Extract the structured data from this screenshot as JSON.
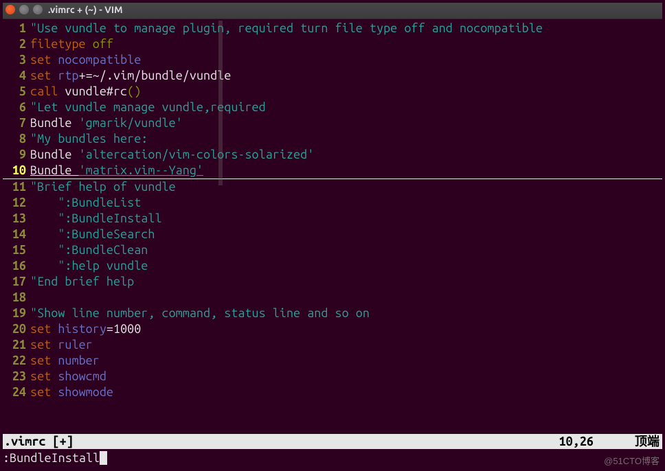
{
  "window": {
    "title": ".vimrc + (~) - VIM"
  },
  "editor": {
    "lines": [
      {
        "n": 1,
        "tokens": [
          {
            "cls": "c-comment",
            "t": "\"Use vundle to manage plugin, required turn file type off and nocompatible"
          }
        ]
      },
      {
        "n": 2,
        "tokens": [
          {
            "cls": "c-statement",
            "t": "filetype"
          },
          {
            "cls": "c-plain",
            "t": " "
          },
          {
            "cls": "c-paren",
            "t": "off"
          }
        ]
      },
      {
        "n": 3,
        "tokens": [
          {
            "cls": "c-statement",
            "t": "set"
          },
          {
            "cls": "c-plain",
            "t": " "
          },
          {
            "cls": "c-option",
            "t": "nocompatible"
          }
        ]
      },
      {
        "n": 4,
        "tokens": [
          {
            "cls": "c-statement",
            "t": "set"
          },
          {
            "cls": "c-plain",
            "t": " "
          },
          {
            "cls": "c-option",
            "t": "rtp"
          },
          {
            "cls": "c-plain",
            "t": "+=~/.vim/bundle/vundle"
          }
        ]
      },
      {
        "n": 5,
        "tokens": [
          {
            "cls": "c-statement",
            "t": "call"
          },
          {
            "cls": "c-plain",
            "t": " "
          },
          {
            "cls": "c-plain",
            "t": "vundle#rc"
          },
          {
            "cls": "c-paren",
            "t": "()"
          }
        ]
      },
      {
        "n": 6,
        "tokens": [
          {
            "cls": "c-comment",
            "t": "\"Let vundle manage vundle,required"
          }
        ]
      },
      {
        "n": 7,
        "tokens": [
          {
            "cls": "c-plain",
            "t": "Bundle "
          },
          {
            "cls": "c-string",
            "t": "'gmarik/vundle'"
          }
        ]
      },
      {
        "n": 8,
        "tokens": [
          {
            "cls": "c-comment",
            "t": "\"My bundles here:"
          }
        ]
      },
      {
        "n": 9,
        "tokens": [
          {
            "cls": "c-plain",
            "t": "Bundle "
          },
          {
            "cls": "c-string",
            "t": "'altercation/vim-colors-solarized'"
          }
        ]
      },
      {
        "n": 10,
        "cur": true,
        "tokens": [
          {
            "cls": "c-curcmd",
            "t": "Bundle "
          },
          {
            "cls": "c-curstr",
            "t": "'matrix.vim--Yang'"
          }
        ]
      },
      {
        "n": 11,
        "tokens": [
          {
            "cls": "c-comment",
            "t": "\"Brief help of vundle"
          }
        ]
      },
      {
        "n": 12,
        "tokens": [
          {
            "cls": "c-comment",
            "t": "    \":BundleList"
          }
        ]
      },
      {
        "n": 13,
        "tokens": [
          {
            "cls": "c-comment",
            "t": "    \":BundleInstall"
          }
        ]
      },
      {
        "n": 14,
        "tokens": [
          {
            "cls": "c-comment",
            "t": "    \":BundleSearch"
          }
        ]
      },
      {
        "n": 15,
        "tokens": [
          {
            "cls": "c-comment",
            "t": "    \":BundleClean"
          }
        ]
      },
      {
        "n": 16,
        "tokens": [
          {
            "cls": "c-comment",
            "t": "    \":help vundle"
          }
        ]
      },
      {
        "n": 17,
        "tokens": [
          {
            "cls": "c-comment",
            "t": "\"End brief help"
          }
        ]
      },
      {
        "n": 18,
        "tokens": [
          {
            "cls": "c-plain",
            "t": ""
          }
        ]
      },
      {
        "n": 19,
        "tokens": [
          {
            "cls": "c-comment",
            "t": "\"Show line number, command, status line and so on"
          }
        ]
      },
      {
        "n": 20,
        "tokens": [
          {
            "cls": "c-statement",
            "t": "set"
          },
          {
            "cls": "c-plain",
            "t": " "
          },
          {
            "cls": "c-option",
            "t": "history"
          },
          {
            "cls": "c-plain",
            "t": "="
          },
          {
            "cls": "c-plain",
            "t": "1000"
          }
        ]
      },
      {
        "n": 21,
        "tokens": [
          {
            "cls": "c-statement",
            "t": "set"
          },
          {
            "cls": "c-plain",
            "t": " "
          },
          {
            "cls": "c-option",
            "t": "ruler"
          }
        ]
      },
      {
        "n": 22,
        "tokens": [
          {
            "cls": "c-statement",
            "t": "set"
          },
          {
            "cls": "c-plain",
            "t": " "
          },
          {
            "cls": "c-option",
            "t": "number"
          }
        ]
      },
      {
        "n": 23,
        "tokens": [
          {
            "cls": "c-statement",
            "t": "set"
          },
          {
            "cls": "c-plain",
            "t": " "
          },
          {
            "cls": "c-option",
            "t": "showcmd"
          }
        ]
      },
      {
        "n": 24,
        "tokens": [
          {
            "cls": "c-statement",
            "t": "set"
          },
          {
            "cls": "c-plain",
            "t": " "
          },
          {
            "cls": "c-option",
            "t": "showmode"
          }
        ]
      }
    ]
  },
  "status": {
    "filename": ".vimrc [+]",
    "position": "10,26",
    "percent": "顶端"
  },
  "cmdline": {
    "text": ":BundleInstall"
  },
  "watermark": "@51CTO博客"
}
